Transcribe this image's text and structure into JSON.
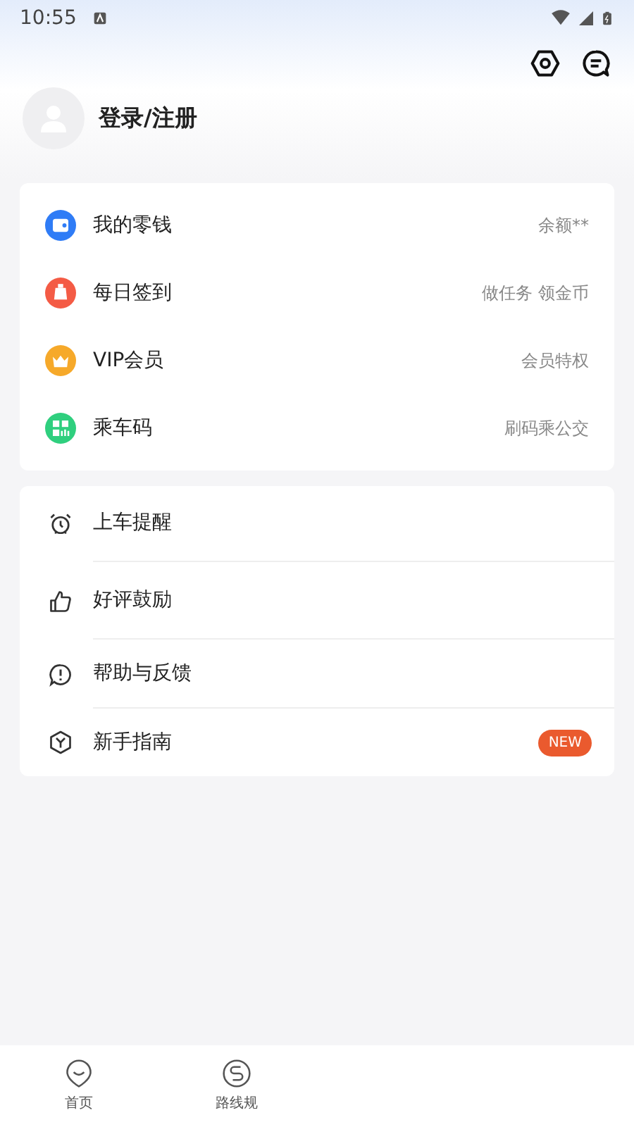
{
  "status_bar": {
    "time": "10:55"
  },
  "profile": {
    "login_label": "登录/注册"
  },
  "wallet_section": [
    {
      "kind": "wallet",
      "label": "我的零钱",
      "hint": "余额**",
      "color": "#2f7cf6"
    },
    {
      "kind": "checkin",
      "label": "每日签到",
      "hint": "做任务 领金币",
      "color": "#f45b45"
    },
    {
      "kind": "vip",
      "label": "VIP会员",
      "hint": "会员特权",
      "color": "#f6a92a"
    },
    {
      "kind": "code",
      "label": "乘车码",
      "hint": "刷码乘公交",
      "color": "#2fcf7e"
    }
  ],
  "service_section": [
    {
      "kind": "alarm",
      "label": "上车提醒"
    },
    {
      "kind": "like",
      "label": "好评鼓励"
    },
    {
      "kind": "help",
      "label": "帮助与反馈"
    },
    {
      "kind": "guide",
      "label": "新手指南",
      "badge": "NEW"
    }
  ],
  "bottom_nav": [
    {
      "kind": "home",
      "label": "首页"
    },
    {
      "kind": "route",
      "label": "路线规"
    }
  ]
}
